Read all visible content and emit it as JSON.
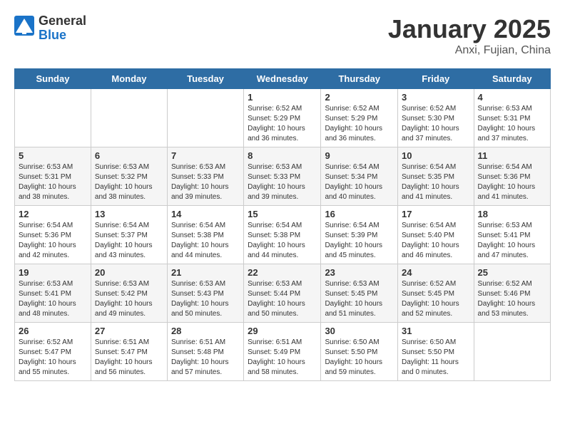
{
  "header": {
    "logo_general": "General",
    "logo_blue": "Blue",
    "calendar_title": "January 2025",
    "calendar_subtitle": "Anxi, Fujian, China"
  },
  "days_of_week": [
    "Sunday",
    "Monday",
    "Tuesday",
    "Wednesday",
    "Thursday",
    "Friday",
    "Saturday"
  ],
  "weeks": [
    [
      {
        "day": "",
        "info": ""
      },
      {
        "day": "",
        "info": ""
      },
      {
        "day": "",
        "info": ""
      },
      {
        "day": "1",
        "info": "Sunrise: 6:52 AM\nSunset: 5:29 PM\nDaylight: 10 hours and 36 minutes."
      },
      {
        "day": "2",
        "info": "Sunrise: 6:52 AM\nSunset: 5:29 PM\nDaylight: 10 hours and 36 minutes."
      },
      {
        "day": "3",
        "info": "Sunrise: 6:52 AM\nSunset: 5:30 PM\nDaylight: 10 hours and 37 minutes."
      },
      {
        "day": "4",
        "info": "Sunrise: 6:53 AM\nSunset: 5:31 PM\nDaylight: 10 hours and 37 minutes."
      }
    ],
    [
      {
        "day": "5",
        "info": "Sunrise: 6:53 AM\nSunset: 5:31 PM\nDaylight: 10 hours and 38 minutes."
      },
      {
        "day": "6",
        "info": "Sunrise: 6:53 AM\nSunset: 5:32 PM\nDaylight: 10 hours and 38 minutes."
      },
      {
        "day": "7",
        "info": "Sunrise: 6:53 AM\nSunset: 5:33 PM\nDaylight: 10 hours and 39 minutes."
      },
      {
        "day": "8",
        "info": "Sunrise: 6:53 AM\nSunset: 5:33 PM\nDaylight: 10 hours and 39 minutes."
      },
      {
        "day": "9",
        "info": "Sunrise: 6:54 AM\nSunset: 5:34 PM\nDaylight: 10 hours and 40 minutes."
      },
      {
        "day": "10",
        "info": "Sunrise: 6:54 AM\nSunset: 5:35 PM\nDaylight: 10 hours and 41 minutes."
      },
      {
        "day": "11",
        "info": "Sunrise: 6:54 AM\nSunset: 5:36 PM\nDaylight: 10 hours and 41 minutes."
      }
    ],
    [
      {
        "day": "12",
        "info": "Sunrise: 6:54 AM\nSunset: 5:36 PM\nDaylight: 10 hours and 42 minutes."
      },
      {
        "day": "13",
        "info": "Sunrise: 6:54 AM\nSunset: 5:37 PM\nDaylight: 10 hours and 43 minutes."
      },
      {
        "day": "14",
        "info": "Sunrise: 6:54 AM\nSunset: 5:38 PM\nDaylight: 10 hours and 44 minutes."
      },
      {
        "day": "15",
        "info": "Sunrise: 6:54 AM\nSunset: 5:38 PM\nDaylight: 10 hours and 44 minutes."
      },
      {
        "day": "16",
        "info": "Sunrise: 6:54 AM\nSunset: 5:39 PM\nDaylight: 10 hours and 45 minutes."
      },
      {
        "day": "17",
        "info": "Sunrise: 6:54 AM\nSunset: 5:40 PM\nDaylight: 10 hours and 46 minutes."
      },
      {
        "day": "18",
        "info": "Sunrise: 6:53 AM\nSunset: 5:41 PM\nDaylight: 10 hours and 47 minutes."
      }
    ],
    [
      {
        "day": "19",
        "info": "Sunrise: 6:53 AM\nSunset: 5:41 PM\nDaylight: 10 hours and 48 minutes."
      },
      {
        "day": "20",
        "info": "Sunrise: 6:53 AM\nSunset: 5:42 PM\nDaylight: 10 hours and 49 minutes."
      },
      {
        "day": "21",
        "info": "Sunrise: 6:53 AM\nSunset: 5:43 PM\nDaylight: 10 hours and 50 minutes."
      },
      {
        "day": "22",
        "info": "Sunrise: 6:53 AM\nSunset: 5:44 PM\nDaylight: 10 hours and 50 minutes."
      },
      {
        "day": "23",
        "info": "Sunrise: 6:53 AM\nSunset: 5:45 PM\nDaylight: 10 hours and 51 minutes."
      },
      {
        "day": "24",
        "info": "Sunrise: 6:52 AM\nSunset: 5:45 PM\nDaylight: 10 hours and 52 minutes."
      },
      {
        "day": "25",
        "info": "Sunrise: 6:52 AM\nSunset: 5:46 PM\nDaylight: 10 hours and 53 minutes."
      }
    ],
    [
      {
        "day": "26",
        "info": "Sunrise: 6:52 AM\nSunset: 5:47 PM\nDaylight: 10 hours and 55 minutes."
      },
      {
        "day": "27",
        "info": "Sunrise: 6:51 AM\nSunset: 5:47 PM\nDaylight: 10 hours and 56 minutes."
      },
      {
        "day": "28",
        "info": "Sunrise: 6:51 AM\nSunset: 5:48 PM\nDaylight: 10 hours and 57 minutes."
      },
      {
        "day": "29",
        "info": "Sunrise: 6:51 AM\nSunset: 5:49 PM\nDaylight: 10 hours and 58 minutes."
      },
      {
        "day": "30",
        "info": "Sunrise: 6:50 AM\nSunset: 5:50 PM\nDaylight: 10 hours and 59 minutes."
      },
      {
        "day": "31",
        "info": "Sunrise: 6:50 AM\nSunset: 5:50 PM\nDaylight: 11 hours and 0 minutes."
      },
      {
        "day": "",
        "info": ""
      }
    ]
  ]
}
